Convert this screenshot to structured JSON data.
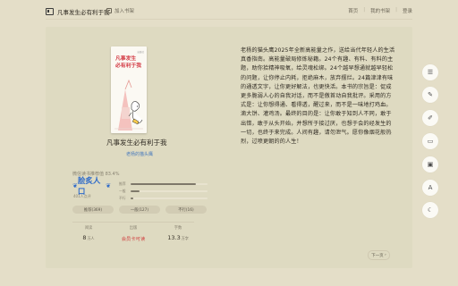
{
  "header": {
    "book_title": "凡事发生必有利于我",
    "add_shelf_label": "加入书架",
    "nav": [
      "首页",
      "我的书架",
      "登录"
    ]
  },
  "book": {
    "cover_title_line1": "凡事发生",
    "cover_title_line2": "必有利于我",
    "cover_publisher_mark": "出版社",
    "title": "凡事发生必有利于我",
    "author": "老杨的猫头鹰"
  },
  "recommendation": {
    "label": "微信读书推荐值 83.4%",
    "badge": "脍炙人口",
    "count": "401人点评",
    "bars": [
      {
        "label": "推荐",
        "fraction": 0.85
      },
      {
        "label": "一般",
        "fraction": 0.12
      },
      {
        "label": "不行",
        "fraction": 0.03
      }
    ]
  },
  "votes": [
    "推荐(369)",
    "一般(127)",
    "不行(16)"
  ],
  "stats": [
    {
      "label": "阅读",
      "value": "8",
      "unit": "万人"
    },
    {
      "label": "出版",
      "value": "会员卡可读",
      "unit": ""
    },
    {
      "label": "字数",
      "value": "13.3",
      "unit": "万字"
    }
  ],
  "intro": "老杨的猫头鹰2025年全新高能量之作，送给当代年轻人的生活真香指南。高能量破局修炼秘籍。24个有趣、有料、有料的主题，助你拾精神吸氧，给灵魂松绑。24个越早想通就越早轻松的问题，让你停止内耗，拒绝麻木，放弃摆烂。24篇津津有味的通透文字，让你更好解法，也更快活。本书的宗旨是：促成更多脆弱人心的自我对话，而不是傲首动自我批评。采用的方式是：让你想得通、看得透，醒过来，而不是一味地打鸡血。滴大饼、灌鸡汤。最终的目的是：让你敢于知到人不同，敢于出错，敢于从头开始，并想所于接过厌，也想于会的经发生的一切，也终于来完成。人间有趣，请勿泄气。愿你像烟花般热烈，过喷更朝的的人生！",
  "next_label": "下一页",
  "side_tools": [
    "list-icon",
    "highlight-icon",
    "pen-icon",
    "comment-icon",
    "image-icon",
    "font-icon",
    "night-mode-icon"
  ]
}
